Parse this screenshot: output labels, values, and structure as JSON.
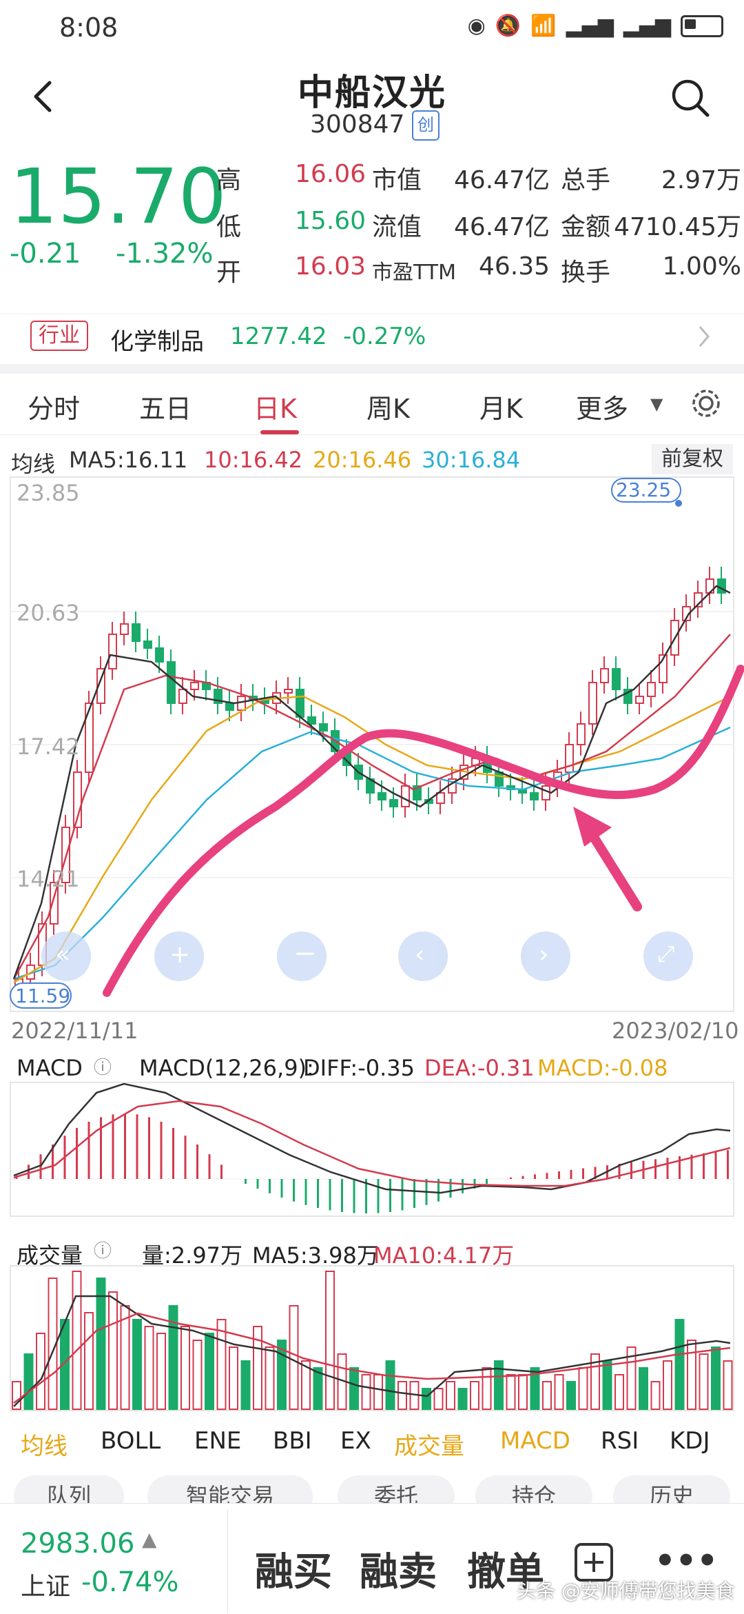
{
  "status_bar": {
    "time": "8:08"
  },
  "header": {
    "title": "中船汉光",
    "code": "300847",
    "board_badge": "创"
  },
  "quote": {
    "price": "15.70",
    "change": "-0.21",
    "change_pct": "-1.32%",
    "high_label": "高",
    "high": "16.06",
    "low_label": "低",
    "low": "15.60",
    "open_label": "开",
    "open": "16.03",
    "mktcap_label": "市值",
    "mktcap": "46.47亿",
    "float_label": "流值",
    "float_cap": "46.47亿",
    "pe_label": "市盈TTM",
    "pe": "46.35",
    "vol_label": "总手",
    "volume": "2.97万",
    "amount_label": "金额",
    "amount": "4710.45万",
    "turnover_label": "换手",
    "turnover": "1.00%"
  },
  "industry": {
    "tag": "行业",
    "name": "化学制品",
    "index": "1277.42",
    "pct": "-0.27%"
  },
  "tabs": [
    "分时",
    "五日",
    "日K",
    "周K",
    "月K",
    "更多"
  ],
  "active_tab": "日K",
  "ma_info": {
    "label": "均线",
    "ma5": "MA5:16.11",
    "ma10": "10:16.42",
    "ma20": "20:16.46",
    "ma30": "30:16.84",
    "adjust": "前复权"
  },
  "kline": {
    "y_ticks": [
      "23.85",
      "20.63",
      "17.42",
      "14.21"
    ],
    "max_label": "23.25",
    "min_label": "11.59",
    "start_date": "2022/11/11",
    "end_date": "2023/02/10"
  },
  "macd": {
    "label": "MACD",
    "params": "MACD(12,26,9):",
    "diff": "DIFF:-0.35",
    "dea": "DEA:-0.31",
    "macd": "MACD:-0.08"
  },
  "vol_panel": {
    "label": "成交量",
    "vol": "量:2.97万",
    "ma5": "MA5:3.98万",
    "ma10": "MA10:4.17万"
  },
  "indicators": [
    "均线",
    "BOLL",
    "ENE",
    "BBI",
    "EX",
    "成交量",
    "MACD",
    "RSI",
    "KDJ"
  ],
  "action_pills": [
    "队列",
    "智能交易",
    "委托",
    "持仓",
    "历史"
  ],
  "footer": {
    "index_value": "2983.06",
    "index_name": "上证",
    "index_pct": "-0.74%",
    "buy": "融买",
    "sell": "融卖",
    "cancel": "撤单",
    "watermark": "头条 @安师傅带您找美食"
  },
  "colors": {
    "up": "#d33a4e",
    "down": "#1aab6b",
    "ma5": "#333333",
    "ma10": "#d33a4e",
    "ma20": "#e6a817",
    "ma30": "#2ab0d8",
    "annotation": "#e8417f"
  }
}
